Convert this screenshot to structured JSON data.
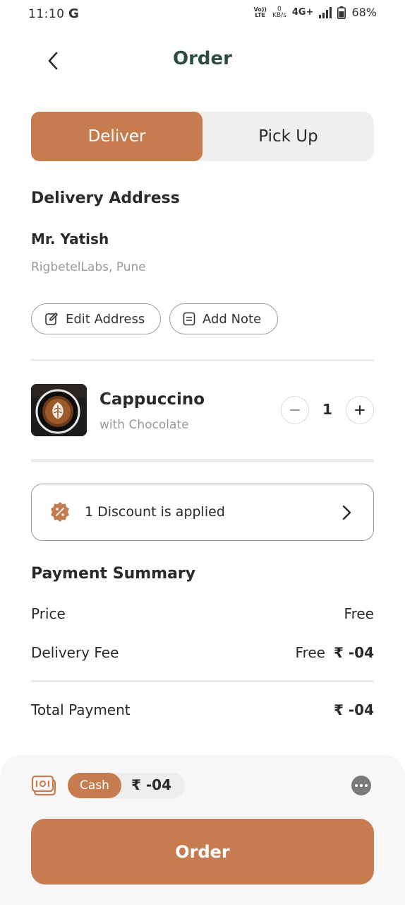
{
  "status_bar": {
    "time": "11:10",
    "g_icon": "G",
    "volte_top": "Vo))",
    "volte_bottom": "LTE",
    "kbs_top": "0",
    "kbs_bottom": "KB/s",
    "network": "4G+",
    "battery": "68%"
  },
  "header": {
    "title": "Order",
    "back_icon": "chevron-left-icon"
  },
  "delivery_mode": {
    "options": [
      "Deliver",
      "Pick Up"
    ],
    "selected": "Deliver",
    "accent_color": "#c67c4e"
  },
  "address": {
    "section_title": "Delivery Address",
    "name": "Mr. Yatish",
    "detail": "RigbetelLabs, Pune",
    "edit_label": "Edit Address",
    "note_label": "Add Note"
  },
  "cart_item": {
    "name": "Cappuccino",
    "variant": "with Chocolate",
    "quantity": "1"
  },
  "discount": {
    "text": "1 Discount is applied"
  },
  "payment_summary": {
    "title": "Payment Summary",
    "price_label": "Price",
    "price_value": "Free",
    "delivery_label": "Delivery Fee",
    "delivery_value": "Free",
    "delivery_amount": "₹ -04",
    "total_label": "Total Payment",
    "total_value": "₹ -04"
  },
  "checkout": {
    "method": "Cash",
    "amount": "₹ -04",
    "order_label": "Order"
  }
}
